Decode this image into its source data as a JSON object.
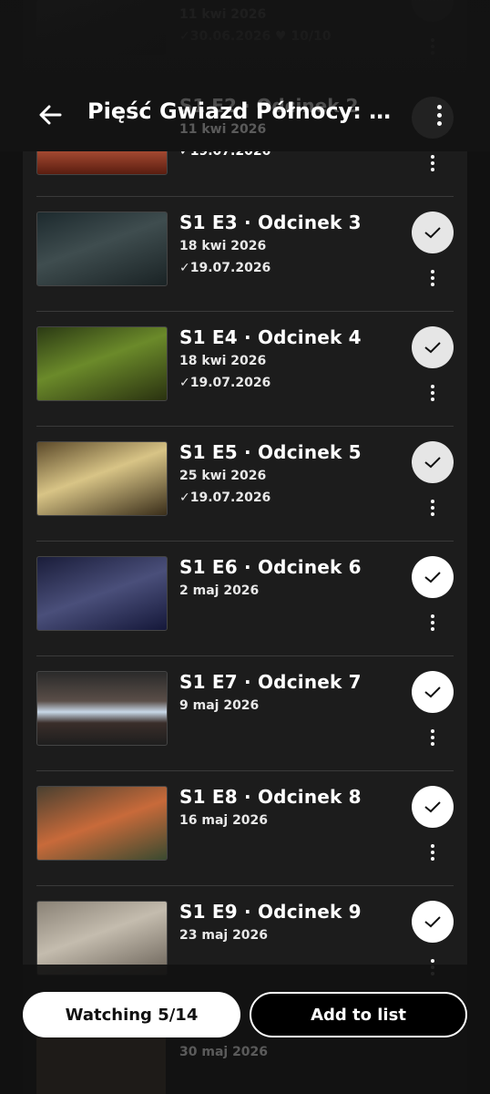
{
  "header": {
    "title": "Pięść Gwiazd Północy: H…",
    "back_icon": "arrow-left-icon",
    "menu_icon": "more-vertical-icon"
  },
  "top_fragment": {
    "date": "11 kwi 2026",
    "watched": "✓30.06.2026",
    "rating": "♥ 10/10",
    "date_overlap": "11 kwi 2026",
    "watched_overlap": "✓19.07.2026",
    "title_overlap": "S1 E2 · Odcinek 2"
  },
  "episodes": [
    {
      "title": "S1 E3 · Odcinek 3",
      "date": "18 kwi 2026",
      "watched": "✓19.07.2026"
    },
    {
      "title": "S1 E4 · Odcinek 4",
      "date": "18 kwi 2026",
      "watched": "✓19.07.2026"
    },
    {
      "title": "S1 E5 · Odcinek 5",
      "date": "25 kwi 2026",
      "watched": "✓19.07.2026"
    },
    {
      "title": "S1 E6 · Odcinek 6",
      "date": "2 maj 2026",
      "watched": ""
    },
    {
      "title": "S1 E7 · Odcinek 7",
      "date": "9 maj 2026",
      "watched": ""
    },
    {
      "title": "S1 E8 · Odcinek 8",
      "date": "16 maj 2026",
      "watched": ""
    },
    {
      "title": "S1 E9 · Odcinek 9",
      "date": "23 maj 2026",
      "watched": ""
    }
  ],
  "under_bottom": {
    "date": "30 maj 2026"
  },
  "bottom_bar": {
    "watching_label": "Watching 5/14",
    "add_label": "Add to list"
  },
  "colors": {
    "background": "#111111",
    "panel": "#1c1c1c",
    "divider": "#3a3a3a",
    "check_button": "#ffffff"
  }
}
